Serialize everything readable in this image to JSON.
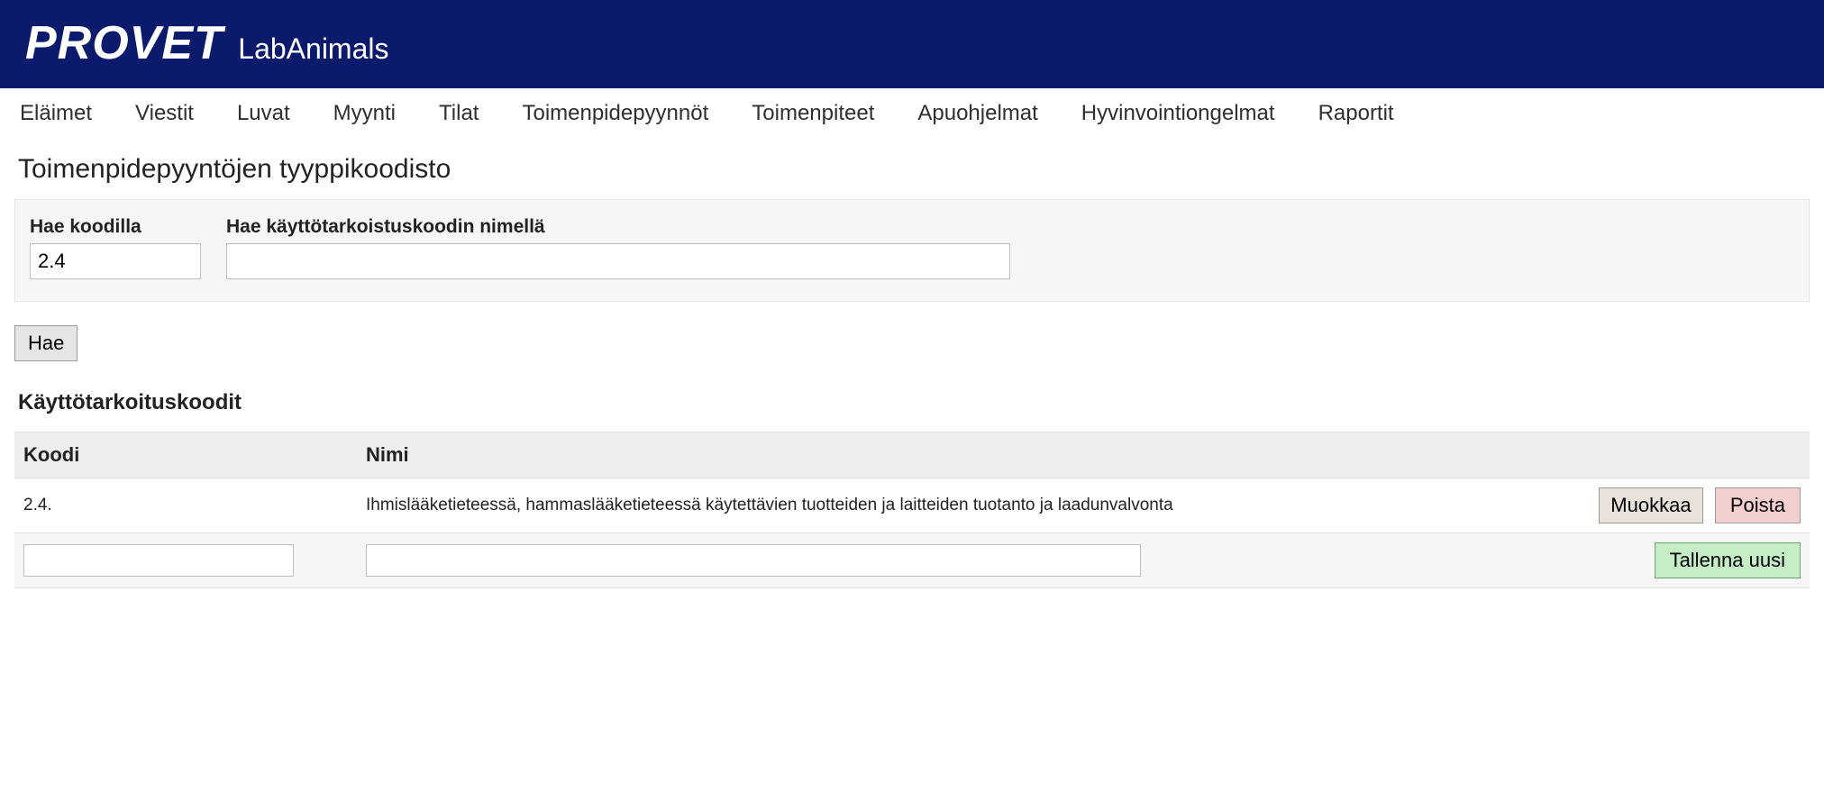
{
  "header": {
    "brand_main": "PROVET",
    "brand_sub": "LabAnimals"
  },
  "nav": {
    "items": [
      {
        "label": "Eläimet"
      },
      {
        "label": "Viestit"
      },
      {
        "label": "Luvat"
      },
      {
        "label": "Myynti"
      },
      {
        "label": "Tilat"
      },
      {
        "label": "Toimenpidepyynnöt"
      },
      {
        "label": "Toimenpiteet"
      },
      {
        "label": "Apuohjelmat"
      },
      {
        "label": "Hyvinvointiongelmat"
      },
      {
        "label": "Raportit"
      }
    ]
  },
  "page": {
    "title": "Toimenpidepyyntöjen tyyppikoodisto"
  },
  "search": {
    "code_label": "Hae koodilla",
    "code_value": "2.4",
    "name_label": "Hae käyttötarkoistuskoodin nimellä",
    "name_value": "",
    "submit_label": "Hae"
  },
  "results": {
    "section_title": "Käyttötarkoituskoodit",
    "columns": {
      "koodi": "Koodi",
      "nimi": "Nimi"
    },
    "rows": [
      {
        "koodi": "2.4.",
        "nimi": "Ihmislääketieteessä, hammaslääketieteessä käytettävien tuotteiden ja laitteiden tuotanto ja laadunvalvonta",
        "edit_label": "Muokkaa",
        "delete_label": "Poista"
      }
    ],
    "new_row": {
      "koodi_value": "",
      "nimi_value": "",
      "save_label": "Tallenna uusi"
    }
  }
}
